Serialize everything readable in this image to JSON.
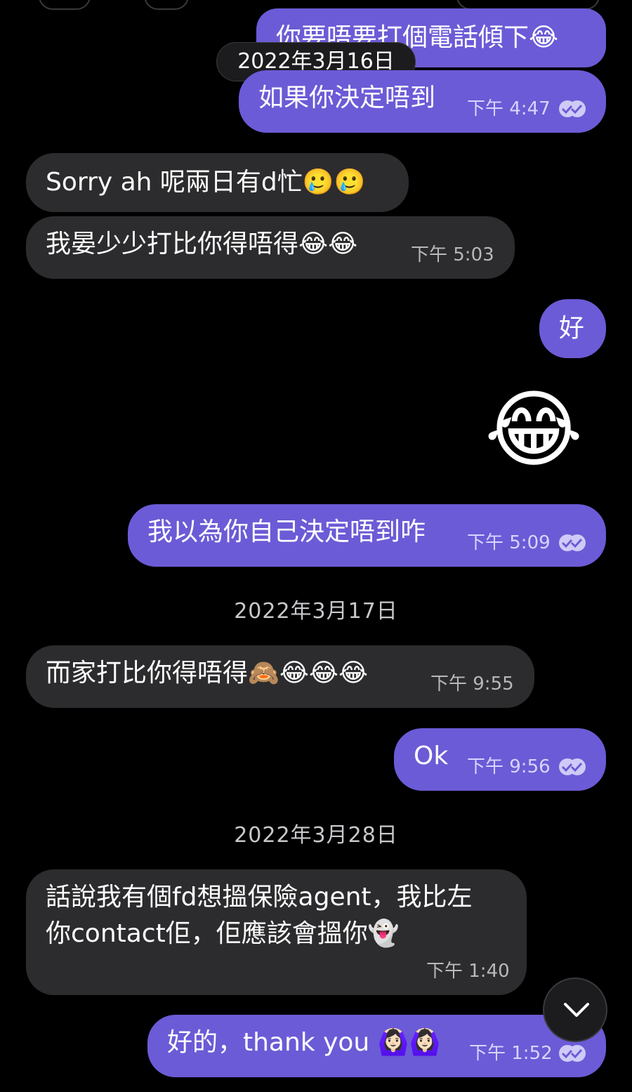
{
  "header": {
    "date_pill": "2022年3月16日"
  },
  "messages": [
    {
      "text": "你要唔要打個電話傾下😂"
    },
    {
      "text": "如果你決定唔到",
      "time": "下午 4:47"
    },
    {
      "text": "Sorry ah 呢兩日有d忙🥲🥲"
    },
    {
      "text": "我晏少少打比你得唔得😂😂",
      "time": "下午 5:03"
    },
    {
      "text": "好"
    },
    {
      "text": "😂"
    },
    {
      "text": "我以為你自己決定唔到咋",
      "time": "下午 5:09"
    },
    {
      "text": "而家打比你得唔得🙈😂😂😂",
      "time": "下午 9:55"
    },
    {
      "text": "Ok",
      "time": "下午 9:56"
    },
    {
      "line1": "話說我有個fd想搵保險agent，我比左",
      "line2": "你contact佢，佢應該會搵你👻",
      "time": "下午 1:40"
    },
    {
      "text": "好的，thank you 🙆🏻‍♀️🙆🏻‍♀️",
      "time": "下午 1:52"
    }
  ],
  "dates": {
    "d17": "2022年3月17日",
    "d28": "2022年3月28日"
  },
  "colors": {
    "outgoing": "#6b5bd6",
    "incoming": "#2c2c2e",
    "background": "#000000"
  },
  "icons": {
    "read_receipt": "double-check-icon",
    "scroll_down": "chevron-down-icon"
  }
}
